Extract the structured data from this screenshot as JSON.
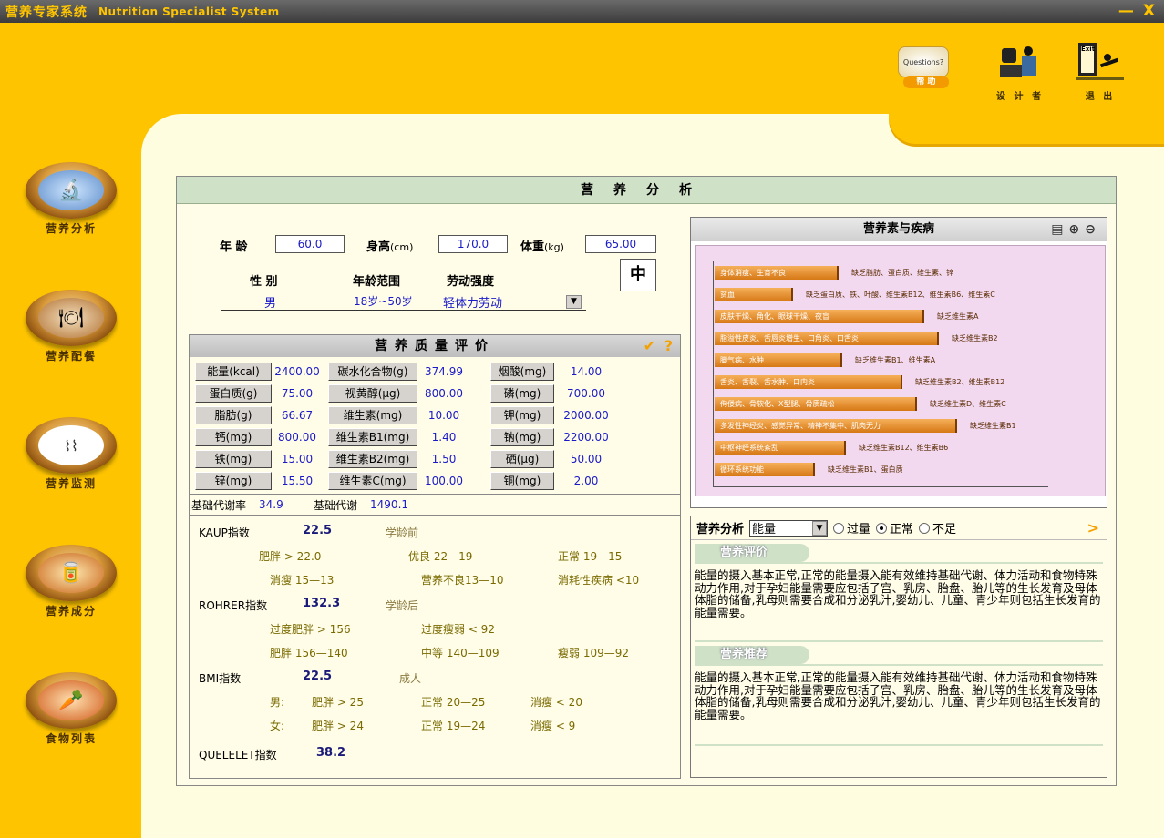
{
  "app": {
    "title_cn": "营养专家系统",
    "title_en": "Nutrition  Specialist  System",
    "minimize": "—",
    "close": "X"
  },
  "top_icons": [
    {
      "label": "帮  助",
      "badge": "Questions?",
      "icon": "help-icon"
    },
    {
      "label": "设 计 者",
      "icon": "designer-icon"
    },
    {
      "label": "退  出",
      "badge": "Exit",
      "icon": "exit-icon"
    }
  ],
  "sidebar": [
    {
      "label": "营养分析",
      "icon": "microscope-icon"
    },
    {
      "label": "营养配餐",
      "icon": "meal-icon"
    },
    {
      "label": "营养监测",
      "icon": "monitor-icon"
    },
    {
      "label": "营养成分",
      "icon": "ingredients-icon"
    },
    {
      "label": "食物列表",
      "icon": "food-list-icon"
    }
  ],
  "panel": {
    "title": "营养分析"
  },
  "form": {
    "age_label": "年  龄",
    "age": "60.0",
    "height_label": "身高",
    "height_unit": "(cm)",
    "height": "170.0",
    "weight_label": "体重",
    "weight_unit": "(kg)",
    "weight": "65.00",
    "sex_label": "性  别",
    "age_range_label": "年龄范围",
    "labor_label": "劳动强度",
    "sex": "男",
    "age_range": "18岁~50岁",
    "labor": "轻体力劳动",
    "grade": "中"
  },
  "eval": {
    "title": "营养质量评价",
    "check": "✔",
    "question": "?"
  },
  "nutrients": [
    [
      {
        "name": "能量(kcal)",
        "value": "2400.00"
      },
      {
        "name": "碳水化合物(g)",
        "value": "374.99"
      },
      {
        "name": "烟酸(mg)",
        "value": "14.00"
      }
    ],
    [
      {
        "name": "蛋白质(g)",
        "value": "75.00"
      },
      {
        "name": "视黄醇(μg)",
        "value": "800.00"
      },
      {
        "name": "磷(mg)",
        "value": "700.00"
      }
    ],
    [
      {
        "name": "脂肪(g)",
        "value": "66.67"
      },
      {
        "name": "维生素(mg)",
        "value": "10.00"
      },
      {
        "name": "钾(mg)",
        "value": "2000.00"
      }
    ],
    [
      {
        "name": "钙(mg)",
        "value": "800.00"
      },
      {
        "name": "维生素B1(mg)",
        "value": "1.40"
      },
      {
        "name": "钠(mg)",
        "value": "2200.00"
      }
    ],
    [
      {
        "name": "铁(mg)",
        "value": "15.00"
      },
      {
        "name": "维生素B2(mg)",
        "value": "1.50"
      },
      {
        "name": "硒(μg)",
        "value": "50.00"
      }
    ],
    [
      {
        "name": "锌(mg)",
        "value": "15.50"
      },
      {
        "name": "维生素C(mg)",
        "value": "100.00"
      },
      {
        "name": "铜(mg)",
        "value": "2.00"
      }
    ]
  ],
  "bmr": {
    "rate_label": "基础代谢率",
    "rate": "34.9",
    "value_label": "基础代谢",
    "value": "1490.1"
  },
  "indices": {
    "kaup": {
      "label": "KAUP指数",
      "value": "22.5",
      "group": "学龄前",
      "r1": [
        "肥胖  > 22.0",
        "优良  22—19",
        "正常  19—15"
      ],
      "r2": [
        "消瘦  15—13",
        "营养不良13—10",
        "消耗性疾病  <10"
      ]
    },
    "rohrer": {
      "label": "ROHRER指数",
      "value": "132.3",
      "group": "学龄后",
      "r1": [
        "过度肥胖 > 156",
        "过度瘦弱 < 92"
      ],
      "r2": [
        "肥胖  156—140",
        "中等  140—109",
        "瘦弱  109—92"
      ]
    },
    "bmi": {
      "label": "BMI指数",
      "value": "22.5",
      "group": "成人",
      "male": [
        "男:",
        "肥胖 > 25",
        "正常 20—25",
        "消瘦 < 20"
      ],
      "female": [
        "女:",
        "肥胖 > 24",
        "正常 19—24",
        "消瘦 < 9"
      ]
    },
    "quetelet": {
      "label": "QUELELET指数",
      "value": "38.2"
    }
  },
  "disease": {
    "title": "营养素与疾病",
    "tools": [
      "document-icon",
      "zoom-in-icon",
      "zoom-out-icon"
    ],
    "rows": [
      {
        "bar": "身体消瘦、生育不良",
        "note": "缺乏脂肪、蛋白质、维生素、锌"
      },
      {
        "bar": "贫血",
        "note": "缺乏蛋白质、铁、叶酸、维生素B12、维生素B6、维生素C"
      },
      {
        "bar": "皮肤干燥、角化、眼球干燥、夜盲",
        "note": "缺乏维生素A"
      },
      {
        "bar": "脂溢性皮炎、舌唇炎增生、口角炎、口舌炎",
        "note": "缺乏维生素B2"
      },
      {
        "bar": "脚气病、水肿",
        "note": "缺乏维生素B1、维生素A"
      },
      {
        "bar": "舌炎、舌裂、舌水肿、口内炎",
        "note": "缺乏维生素B2、维生素B12"
      },
      {
        "bar": "佝偻病、骨软化、X型腿、骨质疏松",
        "note": "缺乏维生素D、维生素C"
      },
      {
        "bar": "多发性神经炎、感觉异常、精神不集中、肌肉无力",
        "note": "缺乏维生素B1"
      },
      {
        "bar": "中枢神经系统紊乱",
        "note": "缺乏维生素B12、维生素B6"
      },
      {
        "bar": "循环系统功能",
        "note": "缺乏维生素B1、蛋白质"
      }
    ]
  },
  "analysis": {
    "label": "营养分析",
    "select": "能量",
    "options": [
      "过量",
      "正常",
      "不足"
    ],
    "selected": 1,
    "next": ">",
    "eval_tag": "营养评价",
    "eval_text": "能量的摄入基本正常,正常的能量摄入能有效维持基础代谢、体力活动和食物特殊动力作用,对于孕妇能量需要应包括子宫、乳房、胎盘、胎儿等的生长发育及母体体脂的储备,乳母则需要合成和分泌乳汁,婴幼儿、儿童、青少年则包括生长发育的能量需要。",
    "rec_tag": "营养推荐",
    "rec_text": "能量的摄入基本正常,正常的能量摄入能有效维持基础代谢、体力活动和食物特殊动力作用,对于孕妇能量需要应包括子宫、乳房、胎盘、胎儿等的生长发育及母体体脂的储备,乳母则需要合成和分泌乳汁,婴幼儿、儿童、青少年则包括生长发育的能量需要。"
  }
}
